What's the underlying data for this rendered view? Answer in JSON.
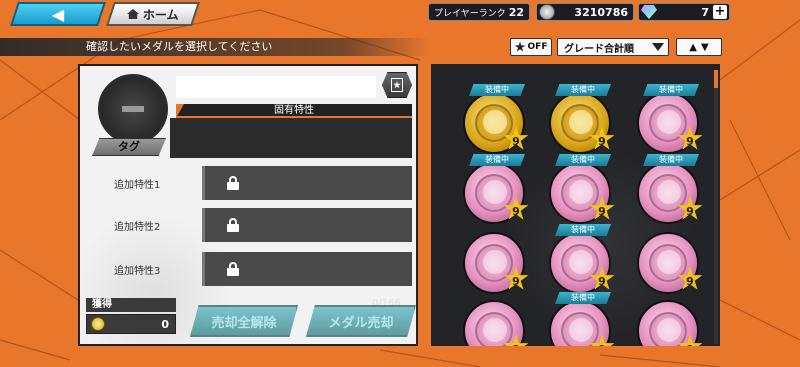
{
  "header": {
    "back_label": "◀",
    "home_label": "ホーム",
    "rank_label": "プレイヤーランク",
    "rank_value": "22",
    "coins": "3210786",
    "gems": "7",
    "plus": "+"
  },
  "instruction": "確認したいメダルを選択してください",
  "controls": {
    "favorite_filter": "OFF",
    "sort_label": "グレード合計順",
    "order_icons": "arrow-up-down-icon"
  },
  "detail": {
    "koyu_label": "固有特性",
    "tag_label": "タグ",
    "traits": [
      "追加特性1",
      "追加特性2",
      "追加特性3"
    ]
  },
  "acquired": {
    "label": "獲得",
    "value": "0"
  },
  "count": "0/166",
  "buttons": {
    "release_all": "売却全解除",
    "sell_medal": "メダル売却"
  },
  "medals": [
    {
      "equipped": "装備中",
      "type": "gold",
      "grade": "9"
    },
    {
      "equipped": "装備中",
      "type": "gold",
      "grade": "9"
    },
    {
      "equipped": "装備中",
      "type": "pink",
      "grade": "9"
    },
    {
      "equipped": "装備中",
      "type": "pink",
      "grade": "9"
    },
    {
      "equipped": "装備中",
      "type": "pink",
      "grade": "9"
    },
    {
      "equipped": "装備中",
      "type": "pink",
      "grade": "9"
    },
    {
      "equipped": "",
      "type": "pink",
      "grade": "9"
    },
    {
      "equipped": "装備中",
      "type": "pink",
      "grade": "9"
    },
    {
      "equipped": "",
      "type": "pink",
      "grade": "9"
    },
    {
      "equipped": "",
      "type": "pink",
      "grade": "9"
    },
    {
      "equipped": "装備中",
      "type": "pink",
      "grade": "9"
    },
    {
      "equipped": "",
      "type": "pink",
      "grade": "9"
    }
  ],
  "colors": {
    "accent": "#e8772c",
    "panel_dark": "#232428",
    "equip_tag": "#1b7c96"
  }
}
